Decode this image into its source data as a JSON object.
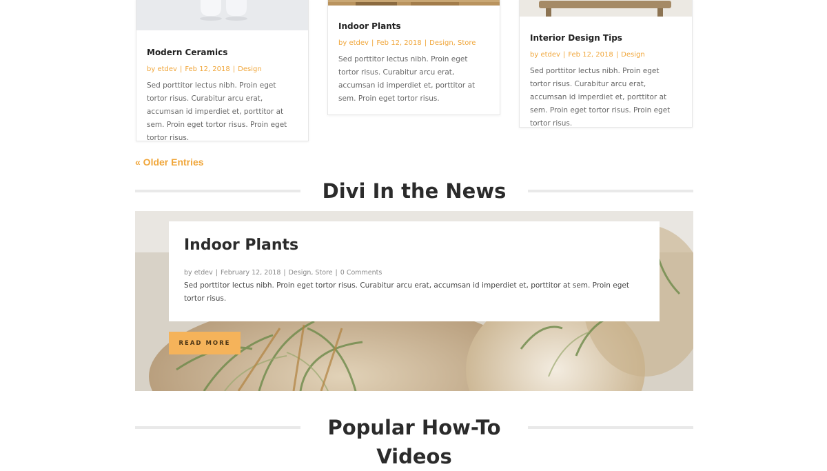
{
  "posts": [
    {
      "title": "Modern Ceramics",
      "author": "etdev",
      "date": "Feb 12, 2018",
      "categories": [
        "Design"
      ],
      "excerpt": "Sed porttitor lectus nibh. Proin eget tortor risus. Curabitur arcu erat, accumsan id imperdiet et, porttitor at sem. Proin eget tortor risus. Proin eget tortor risus."
    },
    {
      "title": "Indoor Plants",
      "author": "etdev",
      "date": "Feb 12, 2018",
      "categories": [
        "Design",
        "Store"
      ],
      "excerpt": "Sed porttitor lectus nibh. Proin eget tortor risus. Curabitur arcu erat, accumsan id imperdiet et, porttitor at sem. Proin eget tortor risus."
    },
    {
      "title": "Interior Design Tips",
      "author": "etdev",
      "date": "Feb 12, 2018",
      "categories": [
        "Design"
      ],
      "excerpt": "Sed porttitor lectus nibh. Proin eget tortor risus. Curabitur arcu erat, accumsan id imperdiet et, porttitor at sem. Proin eget tortor risus. Proin eget tortor risus."
    }
  ],
  "meta_prefix": "by",
  "meta_separator": "|",
  "category_separator": ", ",
  "pagination": {
    "older_entries": "« Older Entries"
  },
  "news_section": {
    "heading": "Divi In the News",
    "post": {
      "title": "Indoor Plants",
      "author": "etdev",
      "date": "February 12, 2018",
      "categories": "Design, Store",
      "comments": "0 Comments",
      "excerpt": "Sed porttitor lectus nibh. Proin eget tortor risus. Curabitur arcu erat, accumsan id imperdiet et, porttitor at sem. Proin eget tortor risus.",
      "button_label": "READ MORE"
    }
  },
  "videos_section": {
    "heading_line1": "Popular How-To",
    "heading_line2": "Videos"
  },
  "colors": {
    "accent": "#f0a63a",
    "button": "#f5b35a",
    "heading": "#2b2b2b",
    "body_text": "#666666",
    "rule": "#e9e9e9"
  }
}
